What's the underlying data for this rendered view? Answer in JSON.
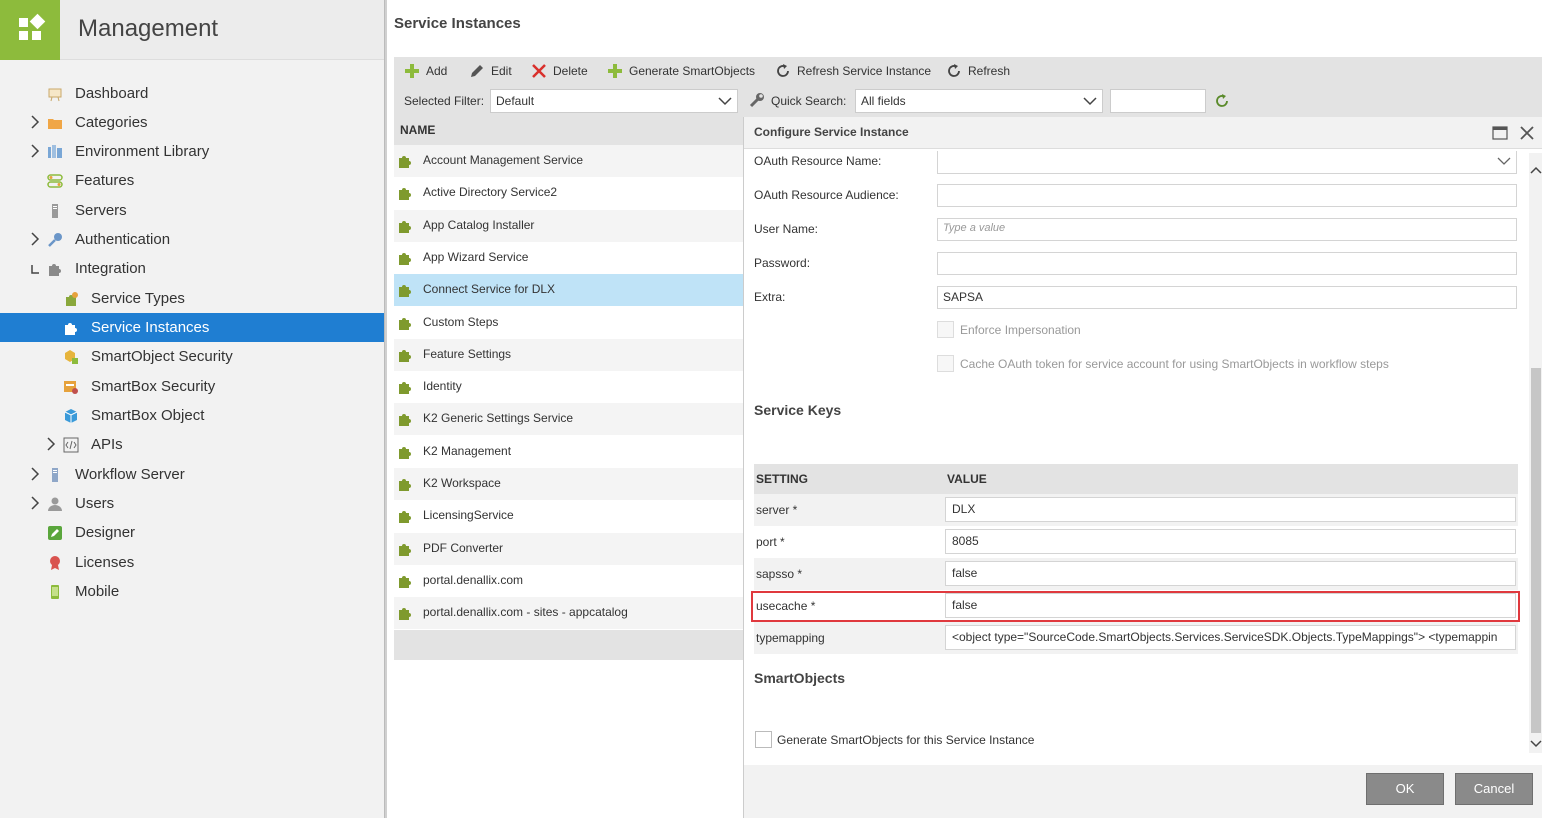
{
  "app": {
    "title": "Management"
  },
  "sidebar": {
    "items": [
      {
        "label": "Dashboard",
        "icon": "dashboard-icon"
      },
      {
        "label": "Categories",
        "icon": "folder-icon"
      },
      {
        "label": "Environment Library",
        "icon": "library-icon"
      },
      {
        "label": "Features",
        "icon": "features-icon"
      },
      {
        "label": "Servers",
        "icon": "server-icon"
      },
      {
        "label": "Authentication",
        "icon": "key-icon"
      },
      {
        "label": "Integration",
        "icon": "puzzle-icon"
      },
      {
        "label": "Service Types",
        "icon": "service-types-icon"
      },
      {
        "label": "Service Instances",
        "icon": "puzzle-icon",
        "selected": true
      },
      {
        "label": "SmartObject Security",
        "icon": "smartobject-security-icon"
      },
      {
        "label": "SmartBox Security",
        "icon": "smartbox-security-icon"
      },
      {
        "label": "SmartBox Object",
        "icon": "smartbox-object-icon"
      },
      {
        "label": "APIs",
        "icon": "api-icon"
      },
      {
        "label": "Workflow Server",
        "icon": "server-icon"
      },
      {
        "label": "Users",
        "icon": "user-icon"
      },
      {
        "label": "Designer",
        "icon": "pencil-icon"
      },
      {
        "label": "Licenses",
        "icon": "ribbon-icon"
      },
      {
        "label": "Mobile",
        "icon": "mobile-icon"
      }
    ]
  },
  "page": {
    "title": "Service Instances"
  },
  "toolbar": {
    "add": "Add",
    "edit": "Edit",
    "delete": "Delete",
    "generate": "Generate SmartObjects",
    "refresh_instance": "Refresh Service Instance",
    "refresh": "Refresh",
    "selected_filter_label": "Selected Filter:",
    "selected_filter_value": "Default",
    "quick_search_label": "Quick Search:",
    "quick_search_value": "All fields",
    "search_text": ""
  },
  "list": {
    "header": "NAME",
    "rows": [
      "Account Management Service",
      "Active Directory Service2",
      "App Catalog Installer",
      "App Wizard Service",
      "Connect Service for DLX",
      "Custom Steps",
      "Feature Settings",
      "Identity",
      "K2 Generic Settings Service",
      "K2 Management",
      "K2 Workspace",
      "LicensingService",
      "PDF Converter",
      "portal.denallix.com",
      "portal.denallix.com - sites - appcatalog"
    ],
    "selected": "Connect Service for DLX"
  },
  "dialog": {
    "title": "Configure Service Instance",
    "fields": {
      "oauth_resource_name_label": "OAuth Resource Name:",
      "oauth_resource_name_value": "",
      "oauth_resource_audience_label": "OAuth Resource Audience:",
      "oauth_resource_audience_value": "",
      "username_label": "User Name:",
      "username_placeholder": "Type a value",
      "password_label": "Password:",
      "password_value": "",
      "extra_label": "Extra:",
      "extra_value": "SAPSA",
      "enforce_impersonation": "Enforce Impersonation",
      "cache_oauth": "Cache OAuth token for service account for using SmartObjects in workflow steps"
    },
    "service_keys": {
      "title": "Service Keys",
      "col_setting": "SETTING",
      "col_value": "VALUE",
      "rows": [
        {
          "setting": "server *",
          "value": "DLX"
        },
        {
          "setting": "port *",
          "value": "8085"
        },
        {
          "setting": "sapsso *",
          "value": "false"
        },
        {
          "setting": "usecache *",
          "value": "false"
        },
        {
          "setting": "typemapping",
          "value": "<object type=\"SourceCode.SmartObjects.Services.ServiceSDK.Objects.TypeMappings\">  <typemappin"
        }
      ],
      "highlighted": "usecache *"
    },
    "smartobjects": {
      "title": "SmartObjects",
      "generate_label": "Generate SmartObjects for this Service Instance"
    },
    "ok": "OK",
    "cancel": "Cancel"
  },
  "colors": {
    "brand_green": "#8dbb3c",
    "selection_blue": "#1f7ed2",
    "row_selected": "#bfe3f7",
    "highlight_red": "#e0393e",
    "button_gray": "#8a8a8a"
  }
}
